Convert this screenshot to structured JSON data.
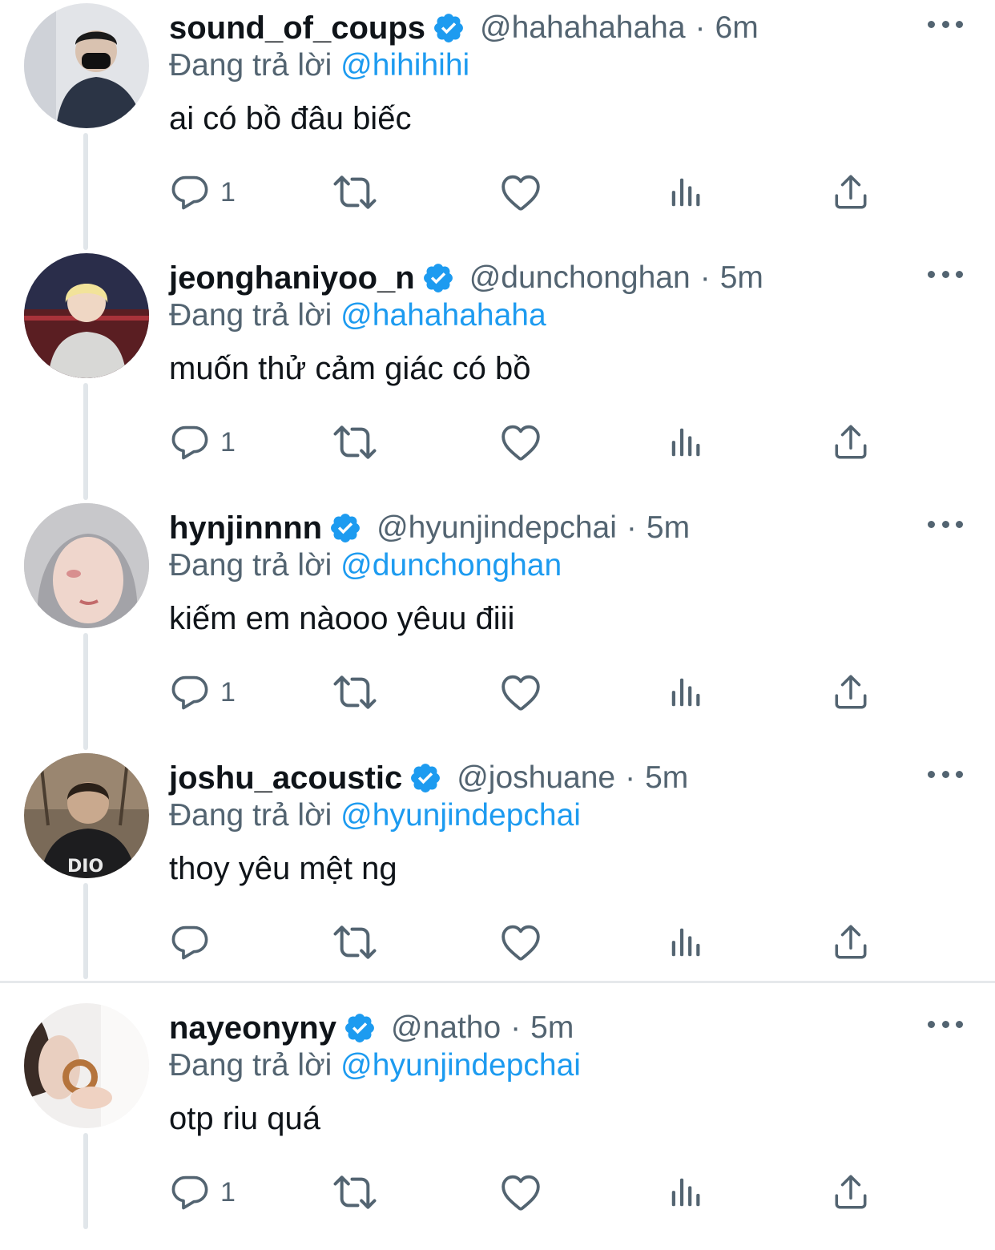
{
  "theme": {
    "text": "#0f1419",
    "secondary": "#536471",
    "accent": "#1d9bf0",
    "thread_line": "#e1e6ea"
  },
  "replying_prefix": "Đang trả lời",
  "tweets": [
    {
      "display_name": "sound_of_coups",
      "handle": "@hahahahaha",
      "time": "6m",
      "replying_to": "@hihihihi",
      "text": "ai có bồ đâu biếc",
      "reply_count": "1",
      "avatar_icon": "avatar-photo-masked-person",
      "verified_icon": "verified-badge-icon"
    },
    {
      "display_name": "jeonghaniyoo_n",
      "handle": "@dunchonghan",
      "time": "5m",
      "replying_to": "@hahahahaha",
      "text": "muốn thử cảm giác có bồ",
      "reply_count": "1",
      "avatar_icon": "avatar-photo-blond-person",
      "verified_icon": "verified-badge-icon"
    },
    {
      "display_name": "hynjinnnn",
      "handle": "@hyunjindepchai",
      "time": "5m",
      "replying_to": "@dunchonghan",
      "text": "kiếm em nàooo yêuu điii",
      "reply_count": "1",
      "avatar_icon": "avatar-photo-hooded-face",
      "verified_icon": "verified-badge-icon"
    },
    {
      "display_name": "joshu_acoustic",
      "handle": "@joshuane",
      "time": "5m",
      "replying_to": "@hyunjindepchai",
      "text": "thoy yêu mệt ng",
      "reply_count": "",
      "avatar_icon": "avatar-photo-person-outdoors",
      "verified_icon": "verified-badge-icon"
    },
    {
      "display_name": "nayeonyny",
      "handle": "@natho",
      "time": "5m",
      "replying_to": "@hyunjindepchai",
      "text": "otp riu quá",
      "reply_count": "1",
      "avatar_icon": "avatar-photo-person-holding-snack",
      "verified_icon": "verified-badge-icon"
    }
  ],
  "action_icons": [
    "reply-icon",
    "retweet-icon",
    "like-icon",
    "views-icon",
    "share-icon"
  ]
}
